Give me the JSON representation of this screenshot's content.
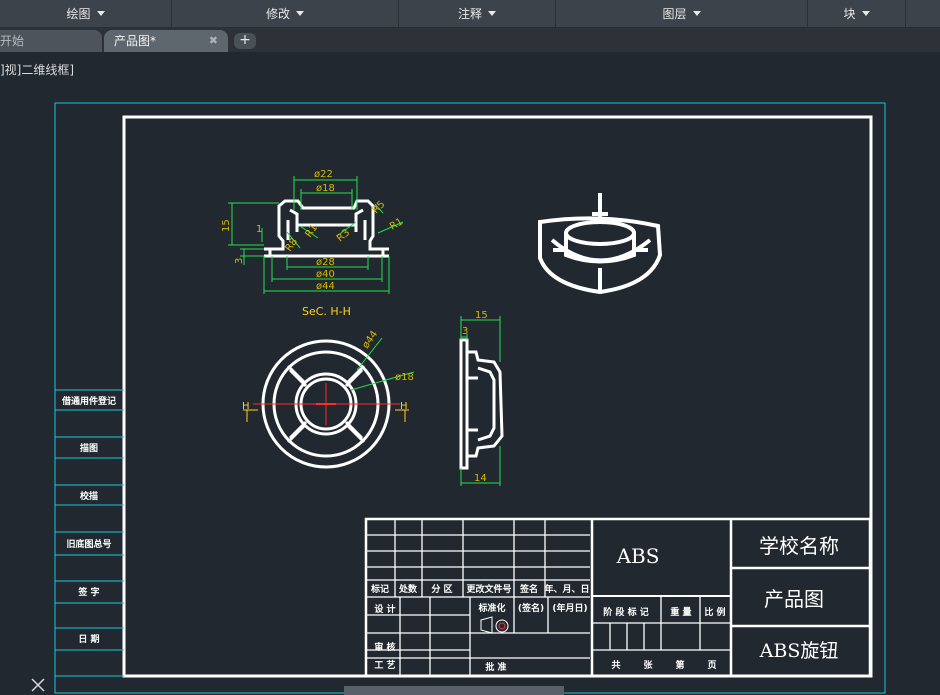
{
  "ribbon": {
    "panels": [
      {
        "label": "绘图"
      },
      {
        "label": "修改"
      },
      {
        "label": "注释"
      },
      {
        "label": "图层"
      },
      {
        "label": "块"
      }
    ]
  },
  "tabs": {
    "start": "开始",
    "document": "产品图*",
    "close_glyph": "✖",
    "add_glyph": "+"
  },
  "viewport": {
    "view_label": "]视]二维线框]"
  },
  "drawing": {
    "section_label": "SeC. H-H",
    "dimensions": {
      "top_22": "ø22",
      "top_18": "ø18",
      "bot_28": "ø28",
      "bot_40": "ø40",
      "bot_44": "ø44",
      "left_15": "15",
      "left_1": "1",
      "left_3": "3",
      "r8": "R8",
      "r1a": "R1",
      "r3": "R3",
      "r5": "R5",
      "r1b": "R1",
      "front_44": "ø44",
      "front_18": "ø18",
      "side_3": "3",
      "side_15": "15",
      "side_14": "14",
      "h_mark": "H"
    },
    "side_table": [
      "借通用件登记",
      "旧底图总号",
      "签 字",
      "日 期",
      "描图",
      "校描"
    ],
    "title_block": {
      "material": "ABS",
      "school": "学校名称",
      "drawing_title": "产品图",
      "part_name": "ABS旋钮",
      "row_labels": [
        "标记",
        "处数",
        "分 区",
        "更改文件号",
        "签名",
        "年、月、日"
      ],
      "design": "设 计",
      "standard": "标准化",
      "sign": "(签名)",
      "date": "(年月日)",
      "review": "审 核",
      "process": "工 艺",
      "approve": "批 准",
      "stage_headers": [
        "阶 段 标 记",
        "重 量",
        "比 例"
      ],
      "sheet": [
        "共",
        "张",
        "第",
        "页"
      ]
    }
  }
}
